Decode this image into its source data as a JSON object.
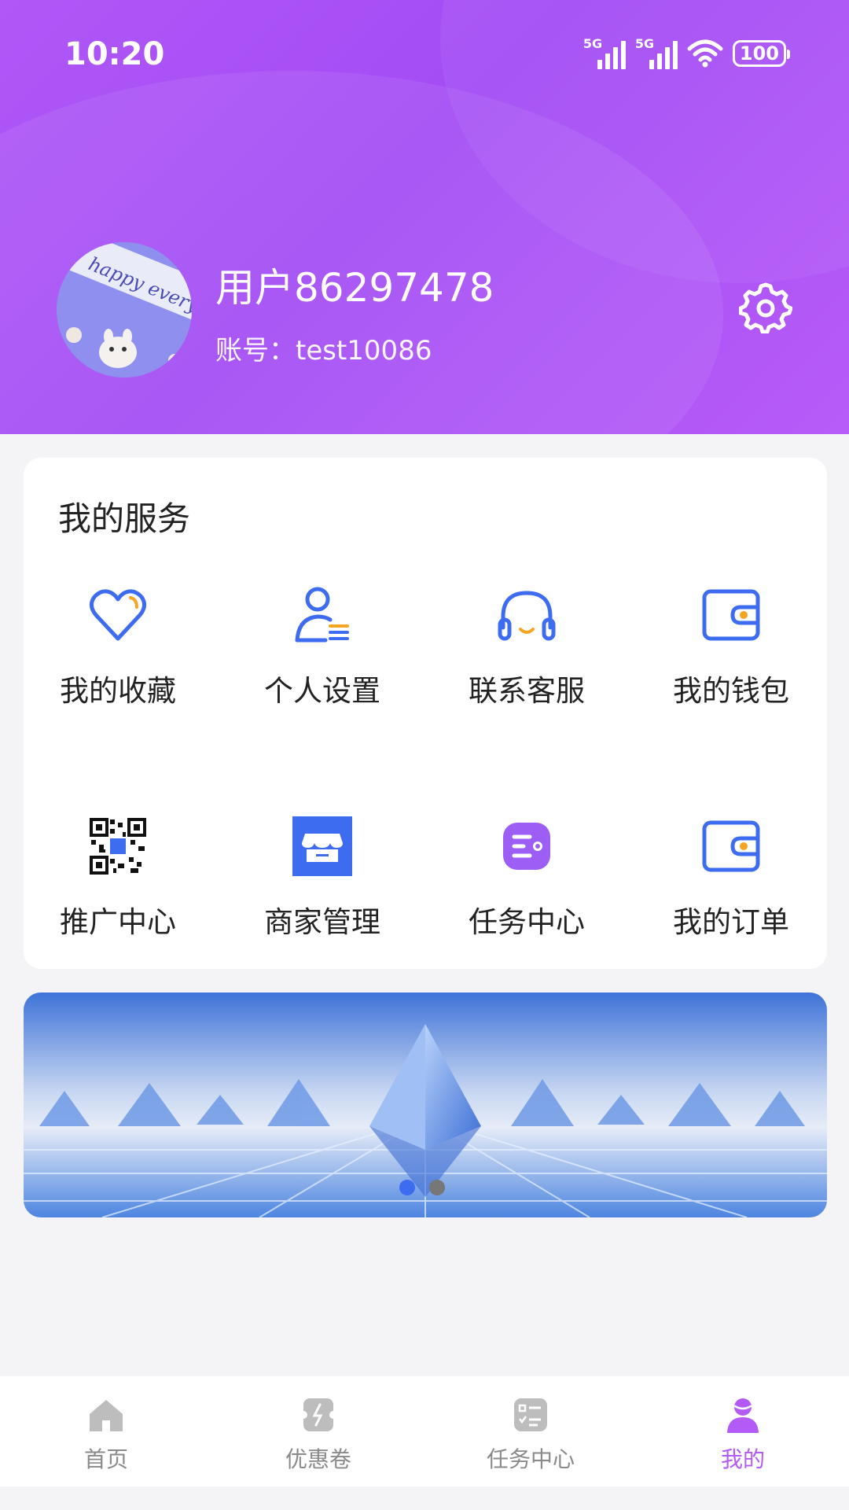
{
  "status_bar": {
    "time": "10:20",
    "signal1_label": "5G",
    "signal2_label": "5G",
    "battery": "100"
  },
  "profile": {
    "username": "用户86297478",
    "account": "账号：test10086"
  },
  "services": {
    "title": "我的服务",
    "items": [
      {
        "label": "我的收藏",
        "icon": "heart-icon"
      },
      {
        "label": "个人设置",
        "icon": "user-settings-icon"
      },
      {
        "label": "联系客服",
        "icon": "headset-icon"
      },
      {
        "label": "我的钱包",
        "icon": "wallet-icon"
      },
      {
        "label": "推广中心",
        "icon": "qr-code-icon"
      },
      {
        "label": "商家管理",
        "icon": "store-icon"
      },
      {
        "label": "任务中心",
        "icon": "task-icon"
      },
      {
        "label": "我的订单",
        "icon": "order-wallet-icon"
      }
    ]
  },
  "banner": {
    "slide_count": 2,
    "active_slide": 1
  },
  "bottom_nav": {
    "active": "我的",
    "items": [
      {
        "label": "首页",
        "icon": "home-icon"
      },
      {
        "label": "优惠卷",
        "icon": "coupon-icon"
      },
      {
        "label": "任务中心",
        "icon": "task-list-icon"
      },
      {
        "label": "我的",
        "icon": "profile-icon"
      }
    ]
  },
  "colors": {
    "header_purple": "#a94ff6",
    "accent_blue": "#3d6cf0",
    "accent_orange": "#f5a524",
    "nav_active": "#b25bf6",
    "nav_inactive": "#8a8a8a"
  }
}
